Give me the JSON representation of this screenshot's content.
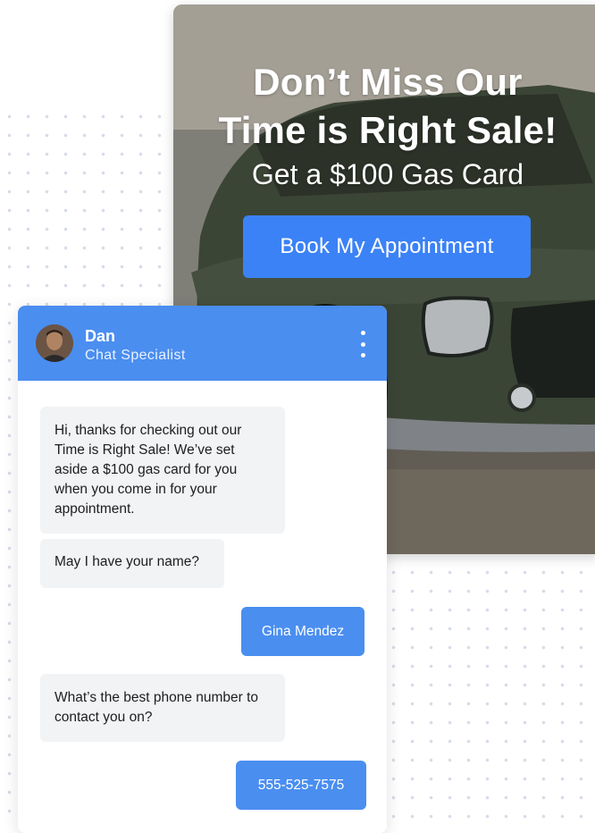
{
  "hero": {
    "title_line1": "Don’t Miss Our",
    "title_line2": "Time is Right Sale!",
    "subtitle": "Get a $100 Gas Card",
    "cta_label": "Book My Appointment"
  },
  "chat": {
    "agent_name": "Dan",
    "agent_role": "Chat Specialist",
    "messages": [
      {
        "sender": "agent",
        "text": "Hi, thanks for checking out our Time is Right Sale! We’ve set aside a $100 gas card for you when you come in for your appointment."
      },
      {
        "sender": "agent",
        "text": "May I have your name?"
      },
      {
        "sender": "user",
        "text": "Gina Mendez"
      },
      {
        "sender": "agent",
        "text": "What’s the best phone number to contact you on?"
      },
      {
        "sender": "user",
        "text": "555-525-7575"
      }
    ]
  },
  "icons": {
    "menu": "vertical-ellipsis-icon"
  },
  "colors": {
    "accent": "#3b82f6",
    "header": "#4a8ef0",
    "agent_bubble": "#f2f3f5"
  }
}
